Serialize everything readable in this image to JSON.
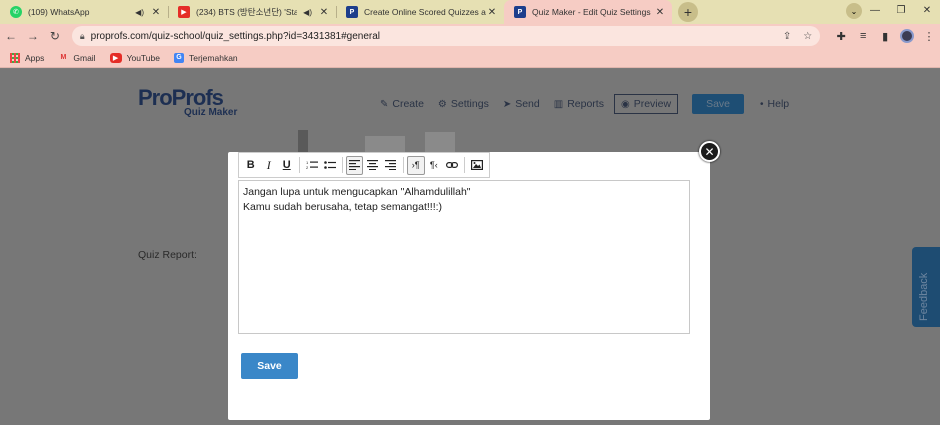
{
  "browser": {
    "tabs": [
      {
        "title": "(109) WhatsApp",
        "favicon": "whatsapp-icon",
        "audio": true,
        "active": false
      },
      {
        "title": "(234) BTS (방탄소년단) 'Stay",
        "favicon": "youtube-icon",
        "audio": true,
        "active": false
      },
      {
        "title": "Create Online Scored Quizzes an",
        "favicon": "proprofs-icon",
        "audio": false,
        "active": false
      },
      {
        "title": "Quiz Maker - Edit Quiz Settings",
        "favicon": "proprofs-icon",
        "audio": false,
        "active": true
      }
    ],
    "url": "proprofs.com/quiz-school/quiz_settings.php?id=3431381#general",
    "bookmarks": [
      "Apps",
      "Gmail",
      "YouTube",
      "Terjemahkan"
    ]
  },
  "page": {
    "logo_main": "ProProfs",
    "logo_sub": "Quiz Maker",
    "nav": {
      "create": "Create",
      "settings": "Settings",
      "send": "Send",
      "reports": "Reports",
      "preview": "Preview",
      "save": "Save",
      "help": "Help"
    },
    "quiz_report_label": "Quiz Report:",
    "feedback_tab": "Feedback"
  },
  "modal": {
    "editor_lines": [
      "Jangan lupa untuk mengucapkan \"Alhamdulillah\"",
      "Kamu sudah berusaha, tetap semangat!!!:)"
    ],
    "save_label": "Save"
  },
  "colors": {
    "accent": "#3a87c8",
    "chrome_active": "#f6ccc4",
    "chrome_tabbar": "#e6e0b3"
  }
}
